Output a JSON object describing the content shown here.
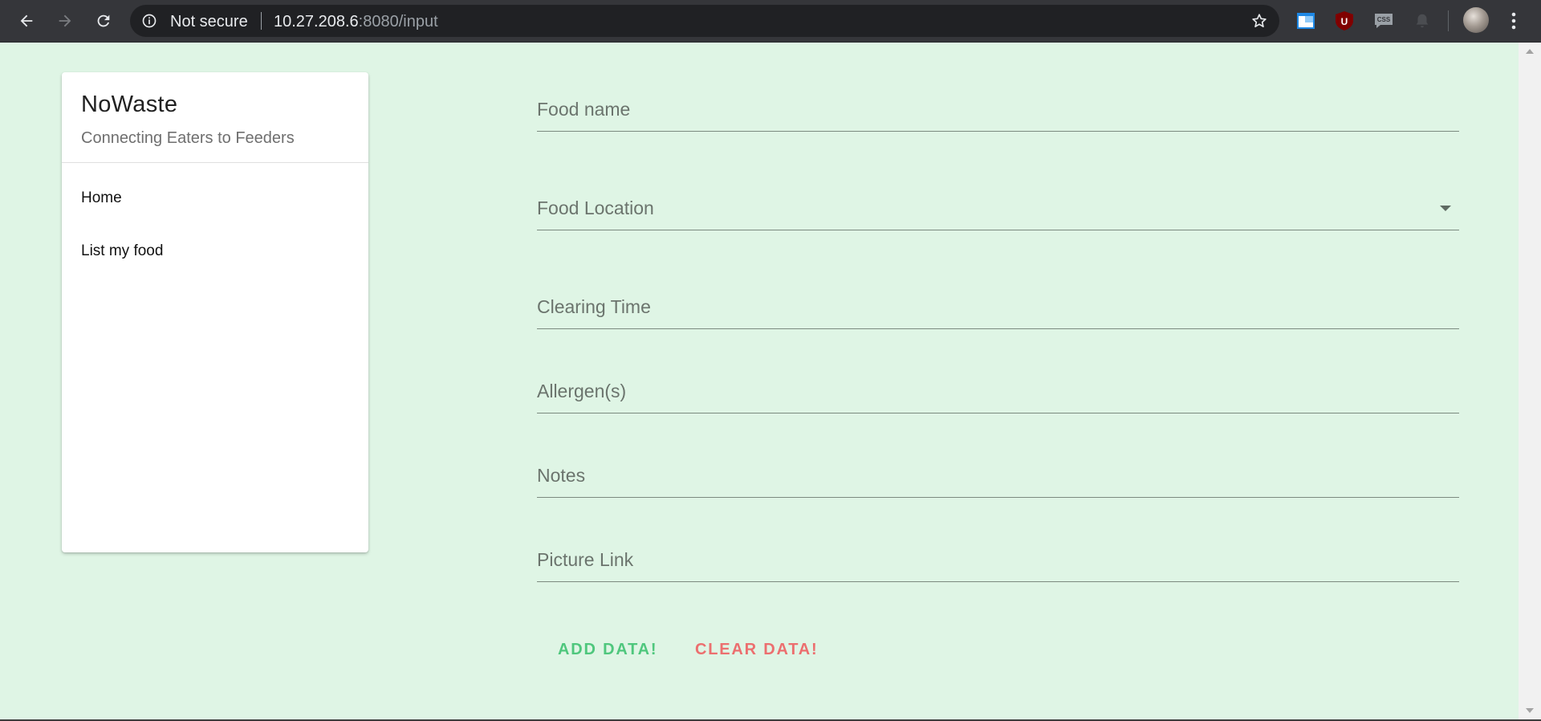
{
  "browser": {
    "security_label": "Not secure",
    "url_host": "10.27.208.6",
    "url_rest": ":8080/input",
    "extensions": [
      "window-extension-icon",
      "ublock-icon",
      "css-extension-icon",
      "bell-extension-icon"
    ]
  },
  "colors": {
    "page_background": "#dff5e5",
    "add_button": "#4fc77d",
    "clear_button": "#ec6f6f"
  },
  "drawer": {
    "title": "NoWaste",
    "subtitle": "Connecting Eaters to Feeders",
    "items": [
      {
        "label": "Home"
      },
      {
        "label": "List my food"
      }
    ]
  },
  "form": {
    "fields": [
      {
        "label": "Food name"
      },
      {
        "label": "Food Location"
      },
      {
        "label": "Clearing Time"
      },
      {
        "label": "Allergen(s)"
      },
      {
        "label": "Notes"
      },
      {
        "label": "Picture Link"
      }
    ],
    "add_label": "ADD DATA!",
    "clear_label": "CLEAR DATA!"
  }
}
